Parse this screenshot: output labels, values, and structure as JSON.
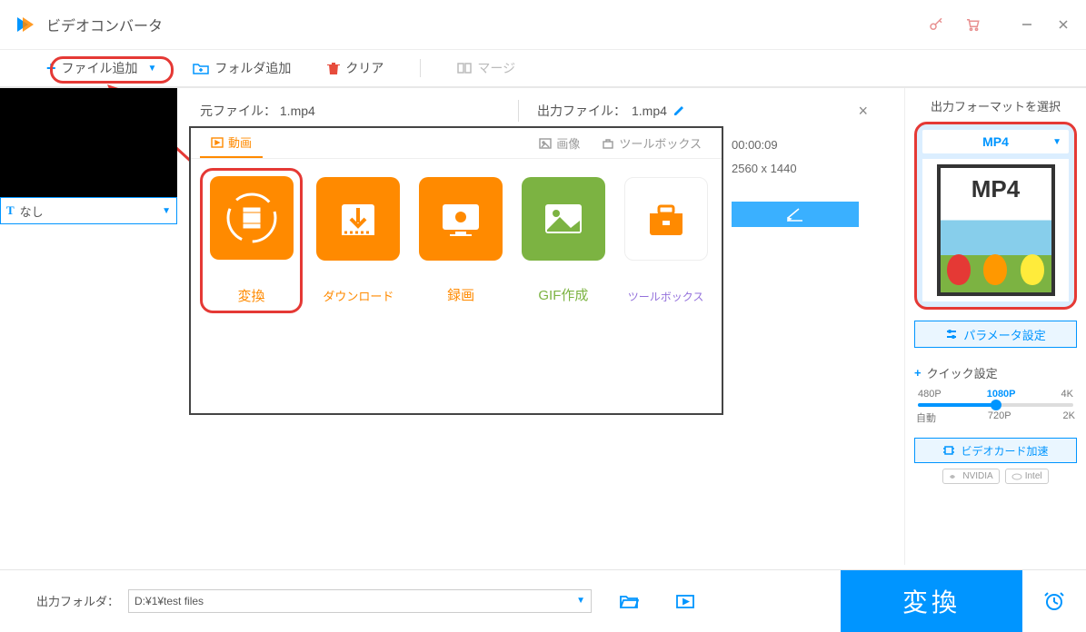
{
  "app": {
    "title": "ビデオコンバータ"
  },
  "toolbar": {
    "add_file": "ファイル追加",
    "add_folder": "フォルダ追加",
    "clear": "クリア",
    "merge": "マージ"
  },
  "file": {
    "source_label": "元ファイル：",
    "source_name": "1.mp4",
    "output_label": "出力ファイル：",
    "output_name": "1.mp4",
    "duration": "00:00:09",
    "resolution": "2560 x 1440"
  },
  "subtitle": {
    "value": "なし"
  },
  "panel": {
    "tabs": {
      "video": "動画",
      "image": "画像",
      "toolbox": "ツールボックス"
    },
    "tiles": {
      "convert": "変換",
      "download": "ダウンロード",
      "record": "録画",
      "gif": "GIF作成",
      "toolbox": "ツールボックス"
    }
  },
  "sidebar": {
    "title": "出力フォーマットを選択",
    "format": "MP4",
    "preview_badge": "MP4",
    "param": "パラメータ設定",
    "quick": "クイック設定",
    "res": {
      "r480": "480P",
      "r1080": "1080P",
      "r4k": "4K",
      "auto": "自動",
      "r720": "720P",
      "r2k": "2K"
    },
    "gpu": "ビデオカード加速",
    "badges": {
      "nvidia": "NVIDIA",
      "intel": "Intel"
    }
  },
  "bottom": {
    "label": "出力フォルダ：",
    "path": "D:¥1¥test files",
    "convert": "変換"
  }
}
